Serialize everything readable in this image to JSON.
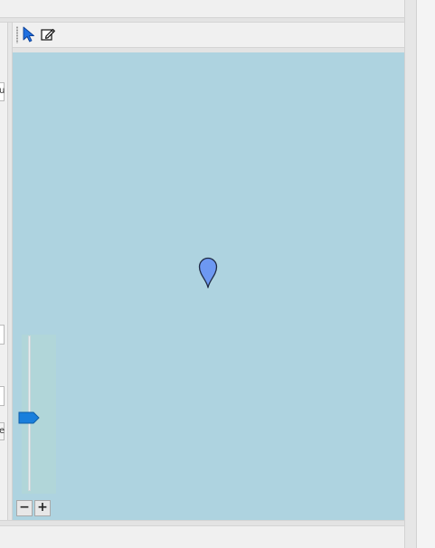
{
  "toolbar": {
    "tools": [
      {
        "name": "select-tool",
        "icon": "cursor-arrow-icon",
        "active": true
      },
      {
        "name": "edit-tool",
        "icon": "pencil-edit-icon",
        "active": false
      }
    ]
  },
  "left_panel": {
    "stub_text_1": "u",
    "stub_text_4": "e"
  },
  "map": {
    "background_color": "#aed3e0",
    "marker": {
      "icon": "map-pin-icon",
      "color": "#6d98f2"
    },
    "zoom": {
      "level_fraction": 0.47,
      "out_label": "−",
      "in_label": "+",
      "thumb_color": "#1a7fdc"
    }
  }
}
